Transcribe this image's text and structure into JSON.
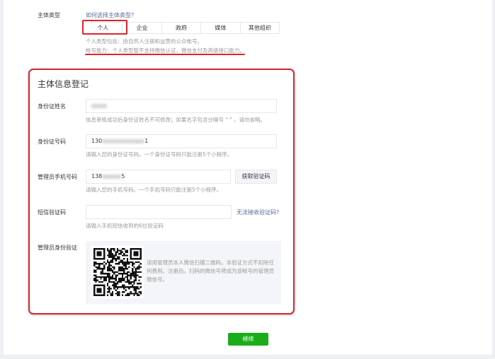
{
  "subject_type": {
    "label": "主体类型",
    "help_link": "如何选择主体类型?",
    "tabs": [
      "个人",
      "企业",
      "政府",
      "媒体",
      "其他组织"
    ],
    "selected": "个人",
    "desc1": "个人类型包括：由自然人注册和运营的公众帐号。",
    "desc2": "帐号能力：个人类型暂不支持微信认证、微信支付及高级接口能力。"
  },
  "form": {
    "title": "主体信息登记",
    "id_name": {
      "label": "身份证姓名",
      "hint": "信息审核成功后身份证姓名不可修改；如果名字包含分隔号 \"·\" ，请勿省略。"
    },
    "id_number": {
      "label": "身份证号码",
      "value_prefix": "130",
      "value_suffix": "1",
      "hint": "请输入您的身份证号码。一个身份证号码只能注册5个小程序。"
    },
    "phone": {
      "label": "管理员手机号码",
      "value_prefix": "138",
      "value_suffix": "5",
      "button": "获取验证码",
      "hint": "请输入您的手机号码。一个手机号码只能注册5个小程序。"
    },
    "sms": {
      "label": "短信验证码",
      "value": "",
      "link": "无法接收验证码?",
      "hint": "请输入手机短信收到的6位验证码"
    },
    "admin_verify": {
      "label": "管理员身份验证",
      "text": "请用管理员本人微信扫描二维码。本验证方式不扣除任何费用。注册后，扫码的微信号将成为该帐号的管理员微信号。"
    }
  },
  "continue_button": "继续",
  "colors": {
    "accent_green": "#1aad19",
    "link": "#576b95",
    "annotation_red": "#e0232b"
  }
}
